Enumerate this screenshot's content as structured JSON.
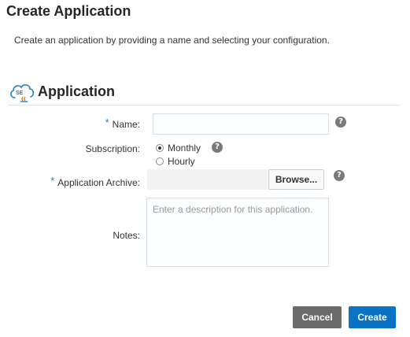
{
  "page": {
    "title": "Create Application",
    "intro": "Create an application by providing a name and selecting your configuration."
  },
  "section": {
    "title": "Application",
    "icon": "java-se-cloud-icon",
    "icon_text": "SE"
  },
  "form": {
    "required_marker": "*",
    "help_glyph": "?",
    "name": {
      "label": "Name:",
      "required": true,
      "value": ""
    },
    "subscription": {
      "label": "Subscription:",
      "options": [
        "Monthly",
        "Hourly"
      ],
      "selected": "Monthly"
    },
    "archive": {
      "label": "Application Archive:",
      "required": true,
      "browse_label": "Browse..."
    },
    "notes": {
      "label": "Notes:",
      "placeholder": "Enter a description for this application."
    }
  },
  "actions": {
    "cancel_label": "Cancel",
    "create_label": "Create"
  },
  "colors": {
    "primary": "#0b73c6",
    "secondary": "#6b6b6b",
    "required": "#1f7ec7",
    "icon": "#1f7ec7"
  }
}
